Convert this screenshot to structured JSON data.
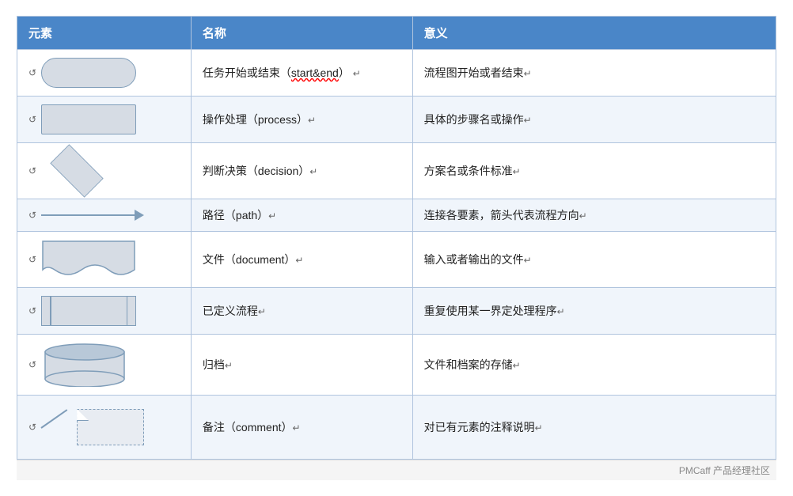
{
  "table": {
    "headers": {
      "element": "元素",
      "name": "名称",
      "meaning": "意义"
    },
    "rows": [
      {
        "shape": "rounded",
        "name": "任务开始或结束（start&end）",
        "name_underline": "start&end",
        "meaning": "流程图开始或者结束"
      },
      {
        "shape": "rect",
        "name": "操作处理（process）",
        "meaning": "具体的步骤名或操作"
      },
      {
        "shape": "diamond",
        "name": "判断决策（decision）",
        "meaning": "方案名或条件标准"
      },
      {
        "shape": "arrow",
        "name": "路径（path）",
        "meaning": "连接各要素，箭头代表流程方向"
      },
      {
        "shape": "document",
        "name": "文件（document）",
        "meaning": "输入或者输出的文件"
      },
      {
        "shape": "predef",
        "name": "已定义流程",
        "meaning": "重复使用某一界定处理程序"
      },
      {
        "shape": "cylinder",
        "name": "归档",
        "meaning": "文件和档案的存储"
      },
      {
        "shape": "comment",
        "name": "备注（comment）",
        "meaning": "对已有元素的注释说明"
      }
    ],
    "footnote": "PMCaff 产品经理社区"
  }
}
